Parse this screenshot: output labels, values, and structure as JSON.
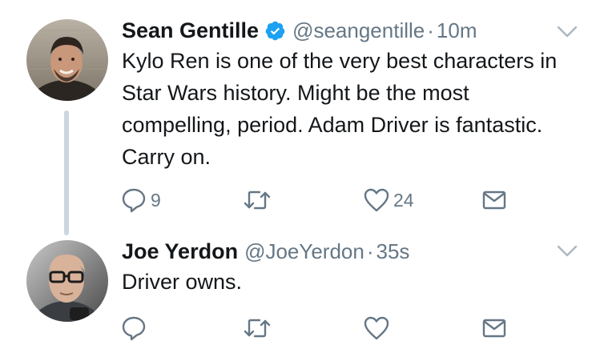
{
  "colors": {
    "verified": "#1da1f2",
    "secondary_text": "#657786",
    "primary_text": "#14171a",
    "thread_line": "#ccd6dd"
  },
  "tweets": [
    {
      "name": "Sean Gentille",
      "verified": true,
      "handle": "@seangentille",
      "separator": "·",
      "time": "10m",
      "text": "Kylo Ren is one of the very best characters in Star Wars history. Might be the most compelling, period. Adam Driver is fantastic. Carry on.",
      "reply_count": "9",
      "retweet_count": "",
      "like_count": "24"
    },
    {
      "name": "Joe Yerdon",
      "verified": false,
      "handle": "@JoeYerdon",
      "separator": "·",
      "time": "35s",
      "text": "Driver owns.",
      "reply_count": "",
      "retweet_count": "",
      "like_count": ""
    }
  ],
  "icons": {
    "reply": "reply-icon",
    "retweet": "retweet-icon",
    "like": "heart-icon",
    "dm": "envelope-icon",
    "more": "chevron-down-icon",
    "verified": "verified-badge-icon"
  }
}
